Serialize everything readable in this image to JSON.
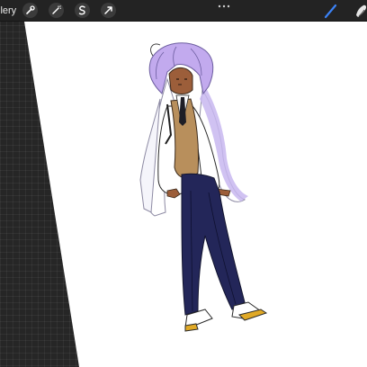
{
  "app": {
    "gallery_label": "llery"
  },
  "toolbar": {
    "icons": [
      "wrench-icon",
      "magic-wand-icon",
      "selection-icon",
      "move-arrow-icon"
    ],
    "more_icon": "ellipsis-icon",
    "right_tools": [
      "brush-icon",
      "smudge-icon"
    ]
  },
  "colors": {
    "toolbar_bg": "#232323",
    "workspace_bg": "#262626",
    "canvas_bg": "#ffffff",
    "active_tool": "#3b82f6",
    "hair": "#c2aaee",
    "vest": "#b88f5c",
    "trousers": "#232659",
    "skin": "#9c5e3a"
  },
  "canvas": {
    "drawing": "character-sketch"
  }
}
